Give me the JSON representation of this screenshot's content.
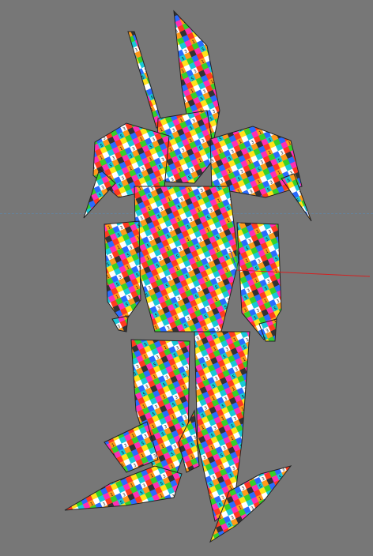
{
  "viewport": {
    "background": "#777777",
    "horizon_color": "#5f86a8",
    "gizmo": {
      "x_axis_color": "#d42020",
      "y_axis_color": "#3a3ad0",
      "z_axis_color": "#20c020"
    }
  },
  "model": {
    "texture": "uv-checker",
    "palette": [
      "#ff3b1f",
      "#ff9a1a",
      "#ffe31a",
      "#35d12a",
      "#19c8d8",
      "#2a6bff",
      "#9b2cff",
      "#ff2fb4",
      "#ffffff",
      "#333333"
    ],
    "checker_labels": [
      "1",
      "2",
      "3",
      "4",
      "5",
      "6",
      "7",
      "8"
    ]
  }
}
